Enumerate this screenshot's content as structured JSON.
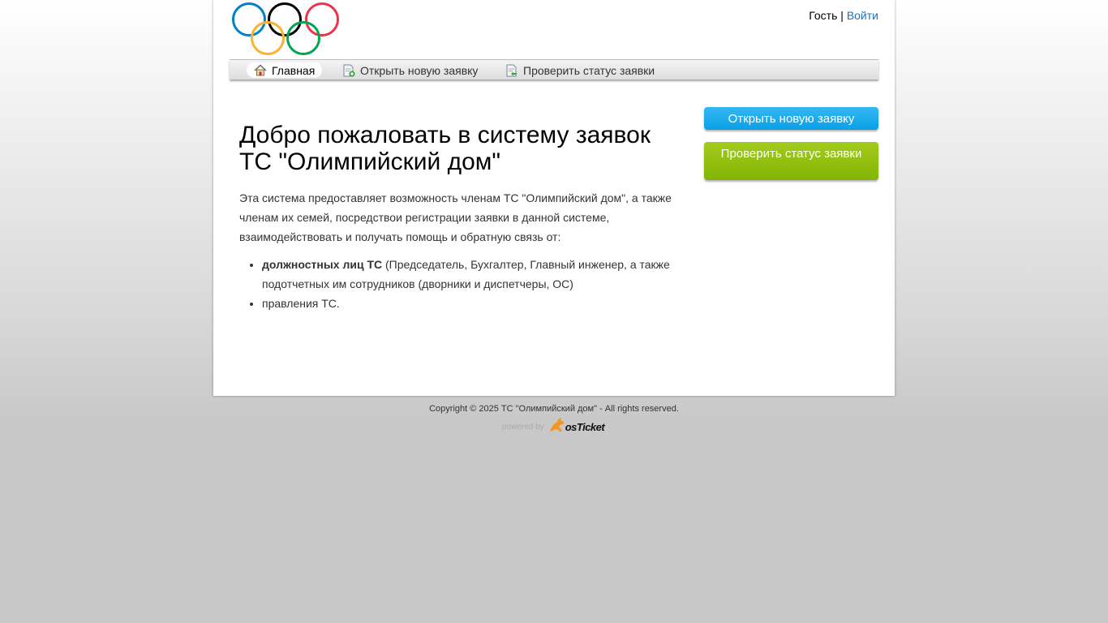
{
  "header": {
    "logo_alt": "Olympic rings logo",
    "user_label": "Гость",
    "separator": "|",
    "login_link": "Войти"
  },
  "nav": {
    "items": [
      {
        "label": "Главная",
        "icon": "home-icon",
        "active": true
      },
      {
        "label": "Открыть новую заявку",
        "icon": "new-ticket-icon",
        "active": false
      },
      {
        "label": "Проверить статус заявки",
        "icon": "ticket-status-icon",
        "active": false
      }
    ]
  },
  "main": {
    "title": "Добро пожаловать в систему заявок ТС \"Олимпийский дом\"",
    "intro": "Эта система предоставляет возможность членам ТС \"Олимпийский дом\", а также членам их семей, посредствои регистрации заявки в данной системе, взаимодействовать и получать помощь и обратную связь от:",
    "list": [
      {
        "bold": "должностных лиц ТС",
        "text": " (Председатель, Бухгалтер, Главный инженер, а также подотчетных им сотрудников (дворники и диспетчеры, ОС)"
      },
      {
        "bold": "",
        "text": "правления ТС."
      }
    ]
  },
  "sidebar": {
    "open_ticket": "Открыть новую заявку",
    "check_status": "Проверить статус заявки"
  },
  "footer": {
    "copyright": "Copyright © 2025 ТС \"Олимпийский дом\" - All rights reserved.",
    "powered_by": "powered by",
    "brand": "osTicket"
  },
  "colors": {
    "link": "#1a73b8",
    "blue_button": "#1eaaec",
    "green_button": "#93bf10",
    "ring_blue": "#0081c8",
    "ring_yellow": "#fcb131",
    "ring_black": "#000000",
    "ring_green": "#00a651",
    "ring_red": "#ee334e"
  }
}
